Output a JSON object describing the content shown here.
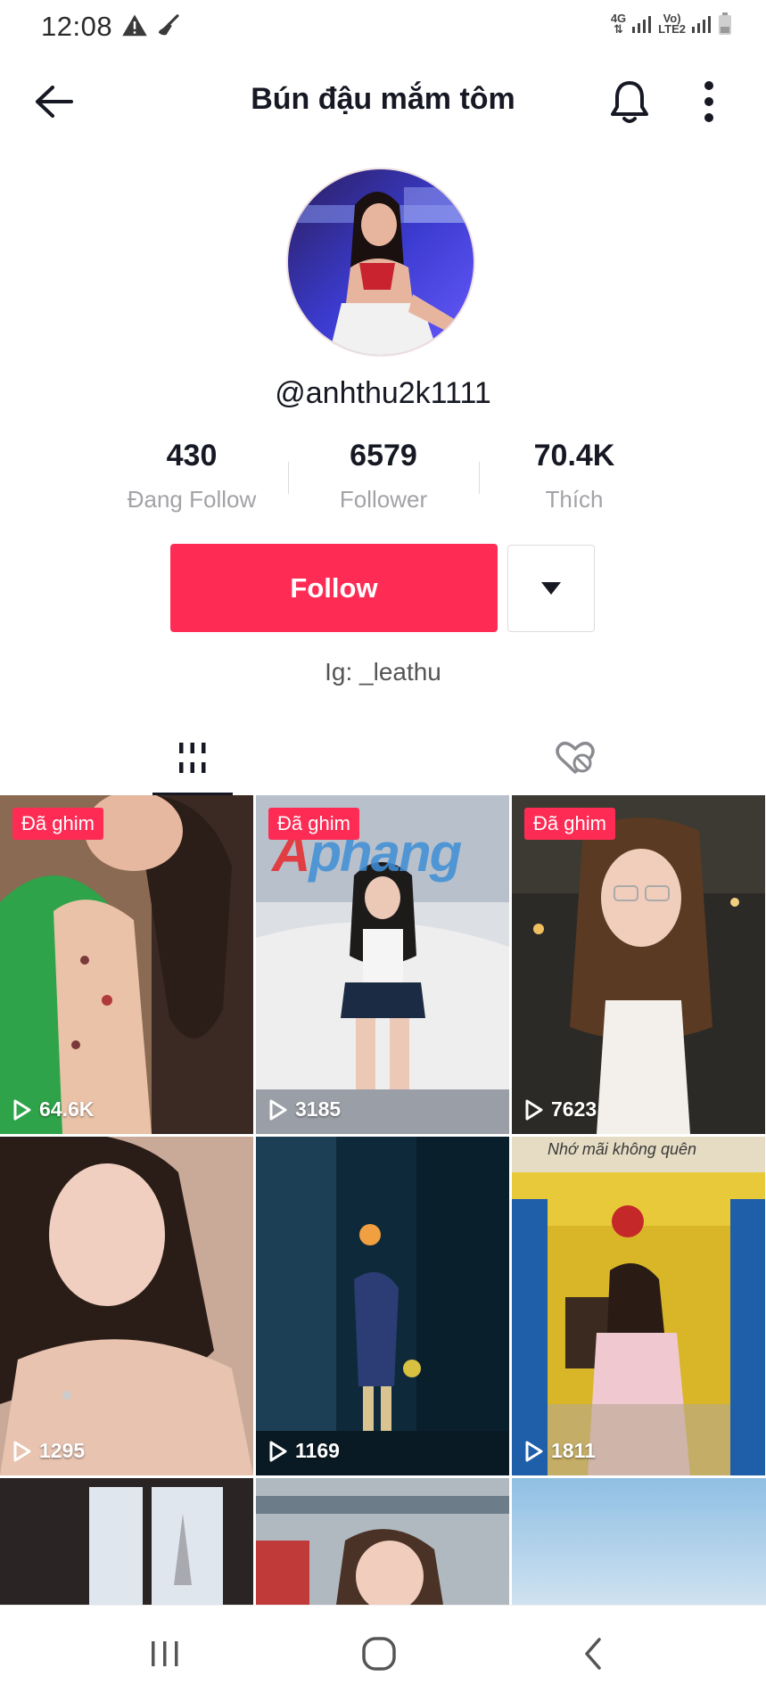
{
  "status_bar": {
    "time": "12:08",
    "left_icons": [
      "warning-icon",
      "broom-icon"
    ],
    "right_labels": {
      "net_top": "4G",
      "volte_top": "Vo)",
      "volte_bottom": "LTE2"
    }
  },
  "header": {
    "title": "Bún đậu mắm tôm",
    "icons": {
      "back": "arrow-left-icon",
      "bell": "bell-icon",
      "more": "more-vertical-icon"
    }
  },
  "profile": {
    "username": "@anhthu2k1111",
    "bio": "Ig: _leathu"
  },
  "stats": [
    {
      "value": "430",
      "label": "Đang Follow"
    },
    {
      "value": "6579",
      "label": "Follower"
    },
    {
      "value": "70.4K",
      "label": "Thích"
    }
  ],
  "actions": {
    "follow_label": "Follow",
    "dropdown_icon": "caret-down-icon"
  },
  "tabs": [
    {
      "icon": "grid-videos-icon",
      "active": true
    },
    {
      "icon": "liked-hidden-icon",
      "active": false
    }
  ],
  "videos": [
    {
      "pinned_label": "Đã ghim",
      "views": "64.6K"
    },
    {
      "pinned_label": "Đã ghim",
      "views": "3185",
      "watermark_a": "A",
      "watermark_rest": "phang"
    },
    {
      "pinned_label": "Đã ghim",
      "views": "7623"
    },
    {
      "views": "1295"
    },
    {
      "views": "1169"
    },
    {
      "views": "1811",
      "sign_text": "Nhớ mãi không quên"
    },
    {
      "views": ""
    },
    {
      "views": ""
    },
    {
      "views": ""
    }
  ],
  "colors": {
    "accent": "#fe2c55",
    "text_primary": "#161823",
    "text_secondary": "#a3a3a8"
  },
  "nav_bar": {
    "icons": [
      "recent-apps-icon",
      "home-icon",
      "back-nav-icon"
    ]
  }
}
